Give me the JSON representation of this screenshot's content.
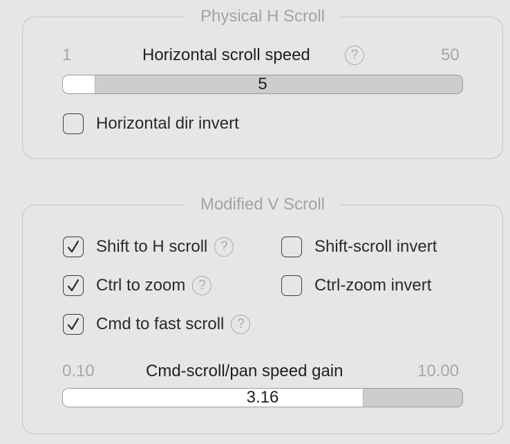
{
  "physical_h_scroll": {
    "title": "Physical H Scroll",
    "speed_slider": {
      "label": "Horizontal scroll speed",
      "min_label": "1",
      "max_label": "50",
      "value_label": "5",
      "fraction": 0.08
    },
    "dir_invert": {
      "label": "Horizontal dir invert",
      "checked": false
    }
  },
  "modified_v_scroll": {
    "title": "Modified V Scroll",
    "options": [
      {
        "label": "Shift to H scroll",
        "checked": true,
        "has_help": true
      },
      {
        "label": "Shift-scroll invert",
        "checked": false,
        "has_help": false
      },
      {
        "label": "Ctrl to zoom",
        "checked": true,
        "has_help": true
      },
      {
        "label": "Ctrl-zoom invert",
        "checked": false,
        "has_help": false
      },
      {
        "label": "Cmd to fast scroll",
        "checked": true,
        "has_help": true
      }
    ],
    "gain_slider": {
      "label": "Cmd-scroll/pan speed gain",
      "min_label": "0.10",
      "max_label": "10.00",
      "value_label": "3.16",
      "fraction": 0.75
    }
  },
  "help_glyph": "?",
  "icons": {
    "help": "question-circle-icon",
    "check": "checkmark-icon"
  }
}
